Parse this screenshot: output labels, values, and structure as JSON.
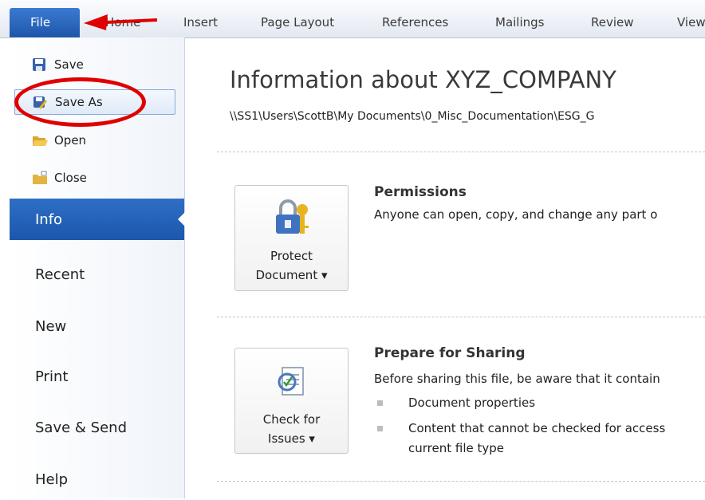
{
  "ribbon": {
    "file_label": "File",
    "tabs": [
      "Home",
      "Insert",
      "Page Layout",
      "References",
      "Mailings",
      "Review",
      "View"
    ]
  },
  "left_nav": {
    "commands": [
      {
        "label": "Save",
        "icon": "save-icon"
      },
      {
        "label": "Save As",
        "icon": "save-as-icon"
      },
      {
        "label": "Open",
        "icon": "open-folder-icon"
      },
      {
        "label": "Close",
        "icon": "close-folder-icon"
      }
    ],
    "items": [
      "Info",
      "Recent",
      "New",
      "Print",
      "Save & Send",
      "Help"
    ],
    "active_item": "Info"
  },
  "info": {
    "title": "Information about XYZ_COMPANY",
    "path": "\\\\SS1\\Users\\ScottB\\My Documents\\0_Misc_Documentation\\ESG_G",
    "permissions": {
      "button_line1": "Protect",
      "button_line2": "Document ▾",
      "heading": "Permissions",
      "text": "Anyone can open, copy, and change any part o"
    },
    "sharing": {
      "button_line1": "Check for",
      "button_line2": "Issues ▾",
      "heading": "Prepare for Sharing",
      "text": "Before sharing this file, be aware that it contain",
      "bullets": [
        "Document properties",
        "Content that cannot be checked for access"
      ],
      "bullet2_cont": "current file type"
    }
  },
  "colors": {
    "accent_blue": "#1e56a8",
    "annotation_red": "#e00000"
  }
}
